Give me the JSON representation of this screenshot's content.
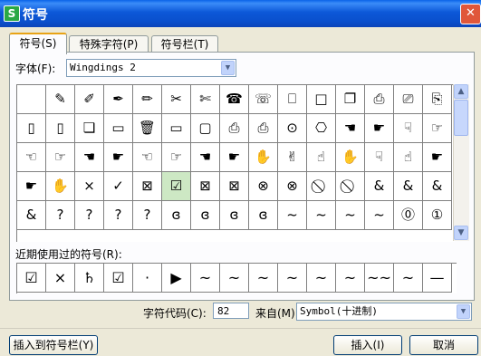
{
  "window": {
    "title": "符号",
    "app_icon": "S",
    "close_glyph": "✕"
  },
  "tabs": [
    {
      "label": "符号(S)"
    },
    {
      "label": "特殊字符(P)"
    },
    {
      "label": "符号栏(T)"
    }
  ],
  "font": {
    "label": "字体(F):",
    "value": "Wingdings 2"
  },
  "symbol_grid": {
    "rows": [
      [
        "",
        "✎",
        "✐",
        "✒",
        "✏",
        "✂",
        "✄",
        "☎",
        "☏",
        "⎕",
        "□",
        "❐",
        "⎙",
        "⎚",
        "⎘",
        "▲"
      ],
      [
        "▯",
        "▯",
        "❏",
        "▭",
        "🗑",
        "▭",
        "▢",
        "⎙",
        "⎙",
        "⊙",
        "⎔",
        "☚",
        "☛",
        "☟",
        "☞",
        "▼"
      ],
      [
        "☜",
        "☞",
        "☚",
        "☛",
        "☜",
        "☞",
        "☚",
        "☛",
        "✋",
        "✌",
        "☝",
        "✋",
        "☟",
        "☝",
        "☛",
        ""
      ],
      [
        "☛",
        "✋",
        "×",
        "✓",
        "⊠",
        "☑",
        "⊠",
        "⊠",
        "⊗",
        "⊗",
        "⃠",
        "⃠",
        "&",
        "&",
        "&",
        ""
      ],
      [
        "&",
        "?",
        "?",
        "?",
        "?",
        "ɞ",
        "ɞ",
        "ɞ",
        "ɞ",
        "~",
        "~",
        "~",
        "~",
        "⓪",
        "①",
        ""
      ]
    ],
    "selected_symbol": "☑"
  },
  "recent": {
    "label": "近期使用过的符号(R):",
    "items": [
      "☑",
      "×",
      "♄",
      "☑",
      "·",
      "▶",
      "~",
      "~",
      "~",
      "~",
      "~",
      "~",
      "~~",
      "~",
      "—"
    ]
  },
  "char_code": {
    "label": "字符代码(C):",
    "value": "82"
  },
  "source": {
    "label": "来自(M)",
    "value": "Symbol(十进制)"
  },
  "buttons": {
    "insert_to_bar": "插入到符号栏(Y)",
    "insert": "插入(I)",
    "cancel": "取消"
  },
  "colors": {
    "title_bar": "#0a4fcc",
    "selected_cell": "#cde8c4",
    "tab_highlight": "#e8a316"
  }
}
